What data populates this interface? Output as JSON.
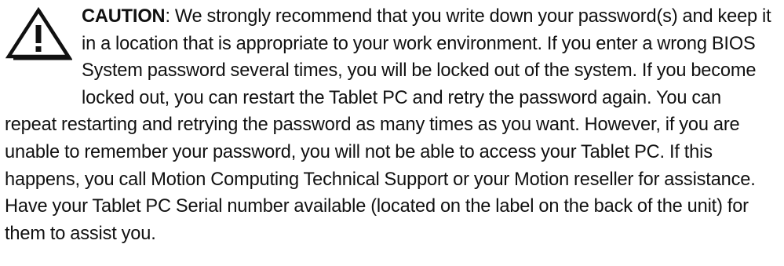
{
  "notice": {
    "icon": "warning-triangle-icon",
    "label": "CAUTION",
    "separator": ":",
    "body": " We strongly recommend that you write down your password(s) and keep it in a location that is appropriate to your work environment. If you enter a wrong BIOS System password several times, you will be locked out of the system. If you become locked out, you can restart the Tablet PC and retry the password again. You can repeat restarting and retrying the password as many times as you want. However, if you are unable to remember your password, you will not be able to access your Tablet PC. If this happens, you call Motion Computing Technical Support or your Motion reseller for assistance. Have your Tablet PC Serial number available (located on the label on the back of the unit) for them to assist you."
  }
}
